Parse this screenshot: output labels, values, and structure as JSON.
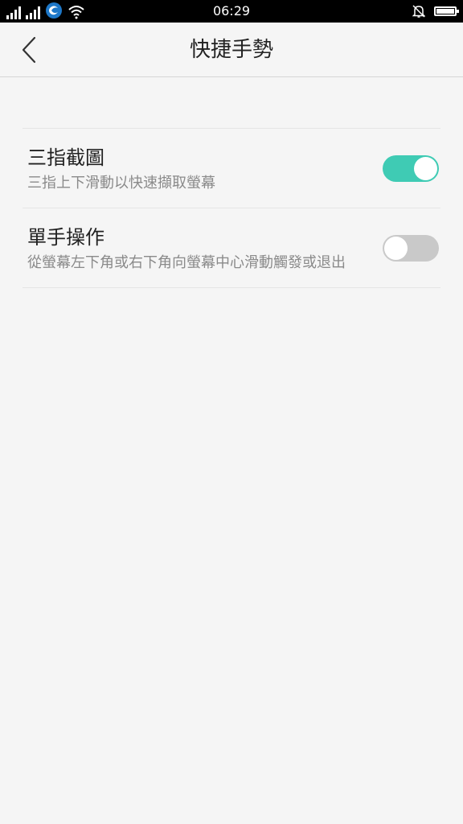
{
  "status_bar": {
    "time": "06:29",
    "icons": [
      "signal-icon",
      "signal-icon",
      "carrier-logo-icon",
      "wifi-icon",
      "mute-bell-icon",
      "battery-icon"
    ]
  },
  "header": {
    "title": "快捷手勢",
    "back_icon": "chevron-left-icon"
  },
  "settings": {
    "items": [
      {
        "title": "三指截圖",
        "subtitle": "三指上下滑動以快速擷取螢幕",
        "enabled": true
      },
      {
        "title": "單手操作",
        "subtitle": "從螢幕左下角或右下角向螢幕中心滑動觸發或退出",
        "enabled": false
      }
    ]
  },
  "colors": {
    "toggle_on": "#3fcbb4",
    "toggle_off": "#c9c9c9",
    "background": "#f5f5f5",
    "status_bar": "#000000"
  }
}
